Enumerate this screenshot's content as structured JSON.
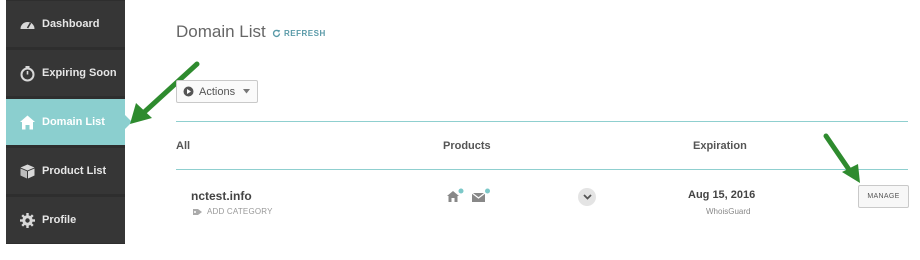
{
  "sidebar": {
    "items": [
      {
        "label": "Dashboard",
        "icon": "dashboard-icon",
        "active": false
      },
      {
        "label": "Expiring Soon",
        "icon": "clock-icon",
        "active": false
      },
      {
        "label": "Domain List",
        "icon": "home-icon",
        "active": true
      },
      {
        "label": "Product List",
        "icon": "box-icon",
        "active": false
      },
      {
        "label": "Profile",
        "icon": "gear-icon",
        "active": false
      }
    ]
  },
  "header": {
    "title": "Domain List",
    "refresh_label": "REFRESH"
  },
  "toolbar": {
    "actions_label": "Actions"
  },
  "table": {
    "columns": [
      "All",
      "Products",
      "Expiration"
    ],
    "rows": [
      {
        "domain": "nctest.info",
        "add_category_label": "ADD CATEGORY",
        "products": [
          "hosting-icon",
          "email-icon"
        ],
        "expiration_date": "Aug 15, 2016",
        "expiration_sub": "WhoisGuard",
        "manage_label": "MANAGE"
      }
    ]
  },
  "colors": {
    "sidebar_bg": "#363636",
    "active_accent": "#8bcfcf",
    "rule_accent": "#8fcfcf",
    "annotation_arrow": "#2e8b2e"
  }
}
